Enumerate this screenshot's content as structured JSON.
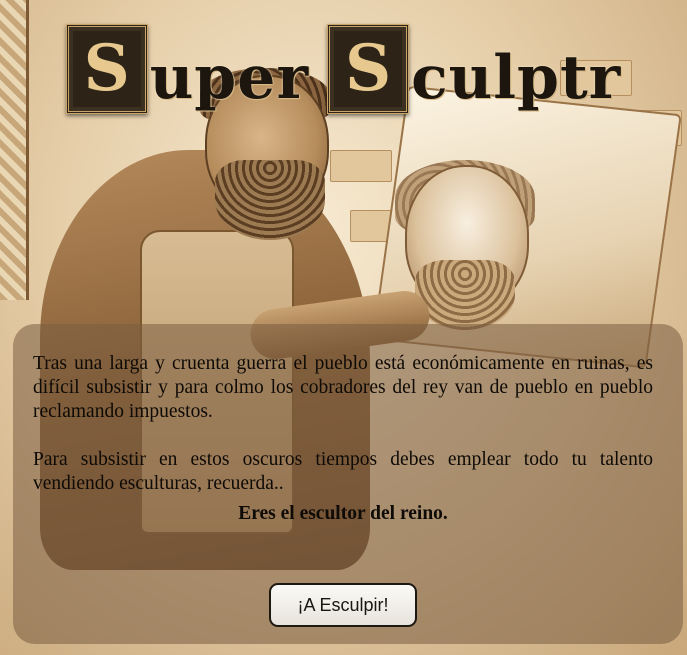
{
  "title": {
    "word1_cap": "S",
    "word1_rest": "uper",
    "word2_cap": "S",
    "word2_rest": "culptr"
  },
  "intro": {
    "paragraph1": "Tras una larga y cruenta guerra el pueblo está económicamente en ruinas, es difícil subsistir y para colmo los cobradores del rey van de pueblo en pueblo reclamando impuestos.",
    "paragraph2": "Para subsistir en estos oscuros tiempos debes emplear todo tu talento vendiendo esculturas, recuerda..",
    "emphasis": "Eres el escultor del reino.",
    "start_button": "¡A Esculpir!"
  },
  "colors": {
    "panel": "#7a5c42",
    "drop_cap_bg": "#2d2417",
    "drop_cap_fg": "#e7c98f"
  }
}
